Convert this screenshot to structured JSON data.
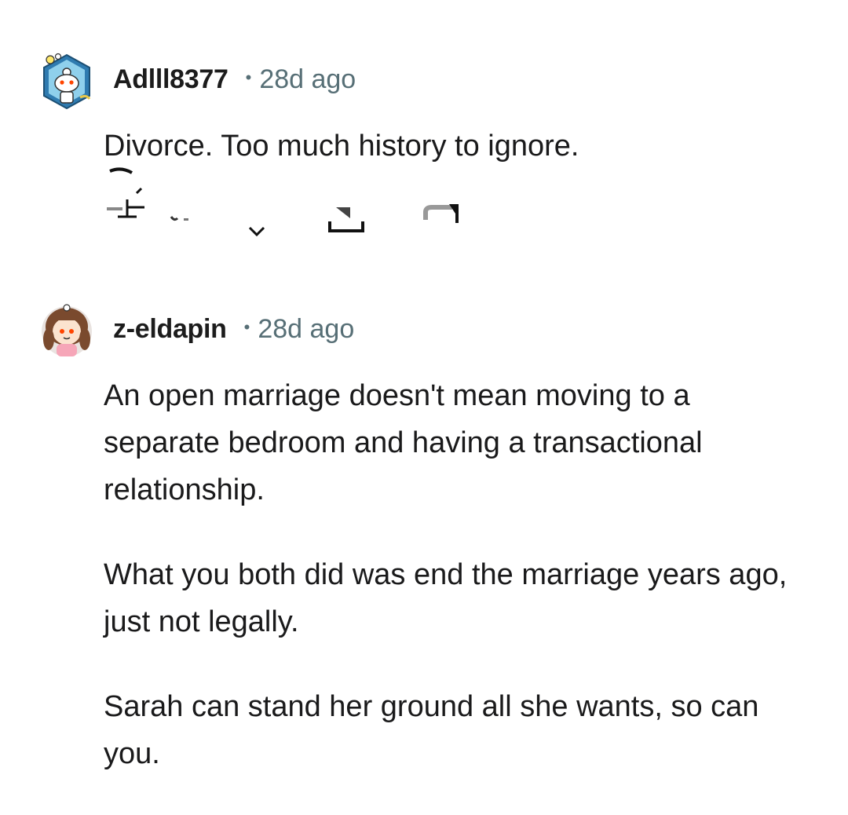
{
  "comments": [
    {
      "username": "Adlll8377",
      "separator": "•",
      "timestamp": "28d ago",
      "paragraphs": [
        "Divorce. Too much history to ignore."
      ],
      "avatar": "reddit-snoo-avatar-icon",
      "actions": [
        "upvote-icon",
        "vote-score",
        "downvote-icon",
        "reply-icon",
        "share-icon"
      ]
    },
    {
      "username": "z-eldapin",
      "separator": "•",
      "timestamp": "28d ago",
      "paragraphs": [
        "An open marriage doesn't mean moving to a separate bedroom and having a transactional relationship.",
        "What you both did was end the marriage years ago, just not legally.",
        "Sarah can stand her ground all she wants, so can you."
      ],
      "avatar": "girl-avatar-icon"
    }
  ],
  "colors": {
    "text": "#1a1a1b",
    "meta": "#576f76",
    "username": "#1c1c1c"
  }
}
